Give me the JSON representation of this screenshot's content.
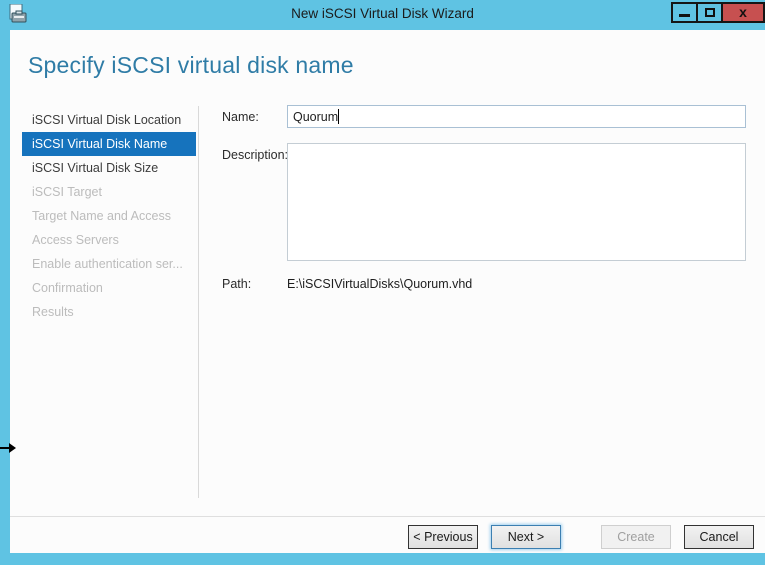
{
  "window": {
    "title": "New iSCSI Virtual Disk Wizard",
    "close_glyph": "x"
  },
  "page": {
    "heading": "Specify iSCSI virtual disk name"
  },
  "sidebar": {
    "items": [
      {
        "label": "iSCSI Virtual Disk Location",
        "state": "enabled"
      },
      {
        "label": "iSCSI Virtual Disk Name",
        "state": "selected"
      },
      {
        "label": "iSCSI Virtual Disk Size",
        "state": "enabled"
      },
      {
        "label": "iSCSI Target",
        "state": "disabled"
      },
      {
        "label": "Target Name and Access",
        "state": "disabled"
      },
      {
        "label": "Access Servers",
        "state": "disabled"
      },
      {
        "label": "Enable authentication ser...",
        "state": "disabled"
      },
      {
        "label": "Confirmation",
        "state": "disabled"
      },
      {
        "label": "Results",
        "state": "disabled"
      }
    ]
  },
  "form": {
    "name_label": "Name:",
    "name_value": "Quorum",
    "description_label": "Description:",
    "description_value": "",
    "path_label": "Path:",
    "path_value": "E:\\iSCSIVirtualDisks\\Quorum.vhd"
  },
  "footer": {
    "previous_label": "< Previous",
    "next_label": "Next >",
    "create_label": "Create",
    "cancel_label": "Cancel"
  },
  "colors": {
    "chrome_blue": "#5fc3e3",
    "close_red": "#c75050",
    "selected_nav_blue": "#1673bd",
    "heading_blue": "#2f7ca6",
    "disabled_text": "#bcbcbc"
  }
}
